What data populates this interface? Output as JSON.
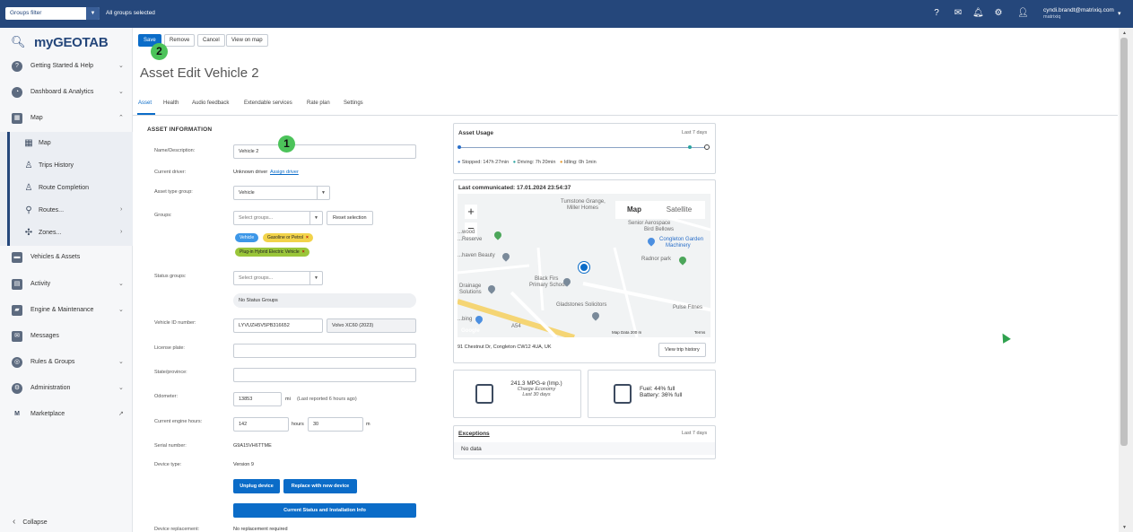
{
  "topbar": {
    "groups_filter_label": "Groups filter",
    "groups_selected": "All groups selected",
    "user_email": "cyndi.brandt@matrixiq.com",
    "user_org": "matrixiq"
  },
  "sidebar": {
    "logo_my": "my",
    "logo_geotab": "GEOTAB",
    "items": [
      {
        "label": "Getting Started & Help",
        "icon": "help-circle-icon"
      },
      {
        "label": "Dashboard & Analytics",
        "icon": "dashboard-icon"
      },
      {
        "label": "Map",
        "icon": "map-icon"
      },
      {
        "label": "Vehicles & Assets",
        "icon": "vehicle-icon"
      },
      {
        "label": "Activity",
        "icon": "activity-icon"
      },
      {
        "label": "Engine & Maintenance",
        "icon": "engine-icon"
      },
      {
        "label": "Messages",
        "icon": "message-icon"
      },
      {
        "label": "Rules & Groups",
        "icon": "rules-icon"
      },
      {
        "label": "Administration",
        "icon": "gear-icon"
      },
      {
        "label": "Marketplace",
        "icon": "marketplace-icon"
      }
    ],
    "map_sub": [
      {
        "label": "Map"
      },
      {
        "label": "Trips History"
      },
      {
        "label": "Route Completion"
      },
      {
        "label": "Routes..."
      },
      {
        "label": "Zones..."
      }
    ],
    "collapse_label": "Collapse"
  },
  "toolbar": {
    "save_label": "Save",
    "remove_label": "Remove",
    "cancel_label": "Cancel",
    "view_on_map_label": "View on map"
  },
  "badges": {
    "one": "1",
    "two": "2"
  },
  "page": {
    "title": "Asset Edit Vehicle 2"
  },
  "tabs": [
    "Asset",
    "Health",
    "Audio feedback",
    "Extendable services",
    "Rate plan",
    "Settings"
  ],
  "form": {
    "section_title": "ASSET INFORMATION",
    "name_label": "Name/Description:",
    "name_value": "Vehicle 2",
    "driver_label": "Current driver:",
    "driver_value": "Unknown driver",
    "assign_driver": "Assign driver",
    "type_group_label": "Asset type group:",
    "type_group_value": "Vehicle",
    "groups_label": "Groups:",
    "groups_placeholder": "Select groups...",
    "reset_selection": "Reset selection",
    "chips": [
      "Vehicle",
      "Gasoline or Petrol",
      "Plug-in Hybrid Electric Vehicle"
    ],
    "status_groups_label": "Status groups:",
    "status_groups_placeholder": "Select groups...",
    "no_status_groups": "No Status Groups",
    "vin_label": "Vehicle ID number:",
    "vin_value": "LYVUZH5V5PB316652",
    "vin_model": "Volvo XC60 (2023)",
    "license_label": "License plate:",
    "state_label": "State/province:",
    "odometer_label": "Odometer:",
    "odometer_value": "13853",
    "odometer_unit": "mi",
    "odometer_note": "(Last reported 6 hours ago)",
    "engine_hours_label": "Current engine hours:",
    "engine_hours_value": "142",
    "hours_unit": "hours",
    "minutes_value": "30",
    "minutes_unit": "m",
    "serial_label": "Serial number:",
    "serial_value": "G9A15VH6TTME",
    "device_type_label": "Device type:",
    "device_type_value": "Version 9",
    "unplug_device": "Unplug device",
    "replace_device": "Replace with new device",
    "status_info": "Current Status and Installation Info",
    "device_replacement_label": "Device replacement:",
    "device_replacement_value": "No replacement required"
  },
  "usage": {
    "title": "Asset Usage",
    "period": "Last 7 days",
    "stopped": "Stopped: 147h 27min",
    "driving": "Driving: 7h 20min",
    "idling": "Idling: 0h 1min"
  },
  "map": {
    "last_communicated": "Last communicated: 17.01.2024 23:54:37",
    "map_tab": "Map",
    "satellite_tab": "Satellite",
    "labels": {
      "tumstone": "Tumstone Grange,",
      "miller": "Miller Homes",
      "senior": "Senior Aerospace",
      "bird": "Bird Bellows",
      "congleton": "Congleton Garden",
      "machinery": "Machinery",
      "radnor": "Radnor park",
      "wood": "...wood",
      "reserve": "...Reserve",
      "beauty": "...haven Beauty",
      "blackfirs": "Black Firs",
      "primary": "Primary School",
      "drainage": "Drainage",
      "solutions": "Solutions",
      "gladstones": "Gladstones Solicitors",
      "pulse": "Pulse Fitnes",
      "bing": "...bing",
      "google": "Google",
      "mapdata": "Map Data  200 m",
      "terms": "Terms",
      "a54": "A54"
    },
    "address": "91 Chestnut Dr, Congleton CW12 4UA, UK",
    "view_trip_history": "View trip history"
  },
  "economy": {
    "value": "241.3 MPG-e (Imp.)",
    "label": "Charge Economy",
    "period": "Last 30 days"
  },
  "fuel": {
    "fuel": "Fuel: 44% full",
    "battery": "Battery: 36% full"
  },
  "exceptions": {
    "title": "Exceptions",
    "period": "Last 7 days",
    "empty": "No data"
  },
  "colors": {
    "topbar": "#25477b",
    "primary": "#0b6cc8",
    "badge": "#4cc35a",
    "chip_vehicle": "#3d97e8",
    "chip_gas": "#f2d34a",
    "chip_phev": "#9ac63a"
  }
}
